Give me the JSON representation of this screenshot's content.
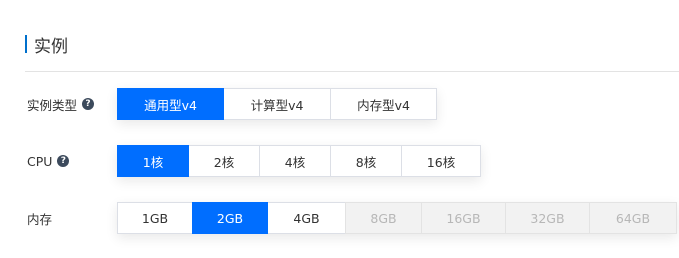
{
  "section": {
    "title": "实例"
  },
  "instance_type": {
    "label": "实例类型",
    "help_icon": "?",
    "options": [
      {
        "label": "通用型v4",
        "state": "active"
      },
      {
        "label": "计算型v4",
        "state": "normal"
      },
      {
        "label": "内存型v4",
        "state": "normal"
      }
    ]
  },
  "cpu": {
    "label": "CPU",
    "help_icon": "?",
    "options": [
      {
        "label": "1核",
        "state": "active"
      },
      {
        "label": "2核",
        "state": "normal"
      },
      {
        "label": "4核",
        "state": "normal"
      },
      {
        "label": "8核",
        "state": "normal"
      },
      {
        "label": "16核",
        "state": "normal"
      }
    ]
  },
  "memory": {
    "label": "内存",
    "options": [
      {
        "label": "1GB",
        "state": "normal"
      },
      {
        "label": "2GB",
        "state": "active"
      },
      {
        "label": "4GB",
        "state": "normal"
      },
      {
        "label": "8GB",
        "state": "disabled"
      },
      {
        "label": "16GB",
        "state": "disabled"
      },
      {
        "label": "32GB",
        "state": "disabled"
      },
      {
        "label": "64GB",
        "state": "disabled"
      }
    ]
  },
  "colors": {
    "accent": "#006eff",
    "section_bar": "#0070cc",
    "disabled_bg": "#f2f2f2"
  }
}
